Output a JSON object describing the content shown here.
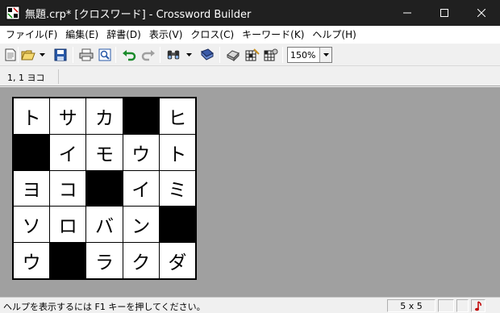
{
  "window": {
    "title": "無題.crp* [クロスワード] - Crossword Builder"
  },
  "menu": [
    "ファイル(F)",
    "編集(E)",
    "辞書(D)",
    "表示(V)",
    "クロス(C)",
    "キーワード(K)",
    "ヘルプ(H)"
  ],
  "toolbar": {
    "zoom": "150%"
  },
  "position": {
    "label": "1, 1  ヨコ"
  },
  "grid": {
    "size": "5 x 5",
    "cells": [
      [
        "ト",
        "サ",
        "カ",
        "#",
        "ヒ"
      ],
      [
        "#",
        "イ",
        "モ",
        "ウ",
        "ト"
      ],
      [
        "ヨ",
        "コ",
        "#",
        "イ",
        "ミ"
      ],
      [
        "ソ",
        "ロ",
        "バ",
        "ン",
        "#"
      ],
      [
        "ウ",
        "#",
        "ラ",
        "ク",
        "ダ"
      ]
    ]
  },
  "statusbar": {
    "message": "ヘルプを表示するには F1 キーを押してください。",
    "size": "5 x 5",
    "icon": "music-note-icon",
    "icon_color": "#c00000"
  }
}
